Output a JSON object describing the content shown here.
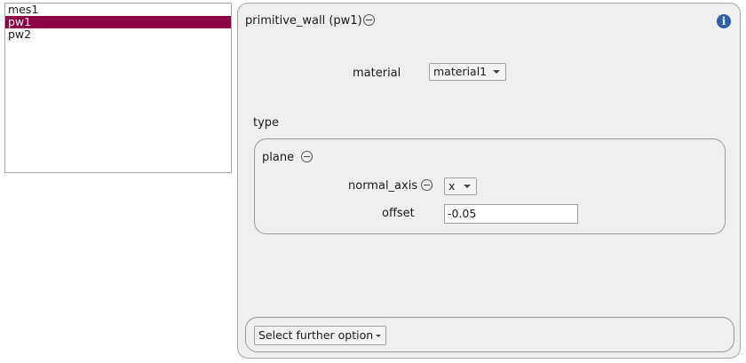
{
  "list": {
    "items": [
      {
        "label": "mes1"
      },
      {
        "label": "pw1"
      },
      {
        "label": "pw2"
      }
    ],
    "selected_index": 1,
    "selection_color": "#8c0046"
  },
  "panel": {
    "title": "primitive_wall (pw1)",
    "material_label": "material",
    "material_value": "material1",
    "type_label": "type",
    "plane": {
      "title": "plane",
      "normal_axis_label": "normal_axis",
      "normal_axis_value": "x",
      "offset_label": "offset",
      "offset_value": "-0.05"
    },
    "further_option_label": "Select further option",
    "info_icon_glyph": "i"
  },
  "icons": {
    "remove": "minus-circle-icon",
    "info": "info-icon",
    "dropdown": "chevron-down-icon"
  }
}
